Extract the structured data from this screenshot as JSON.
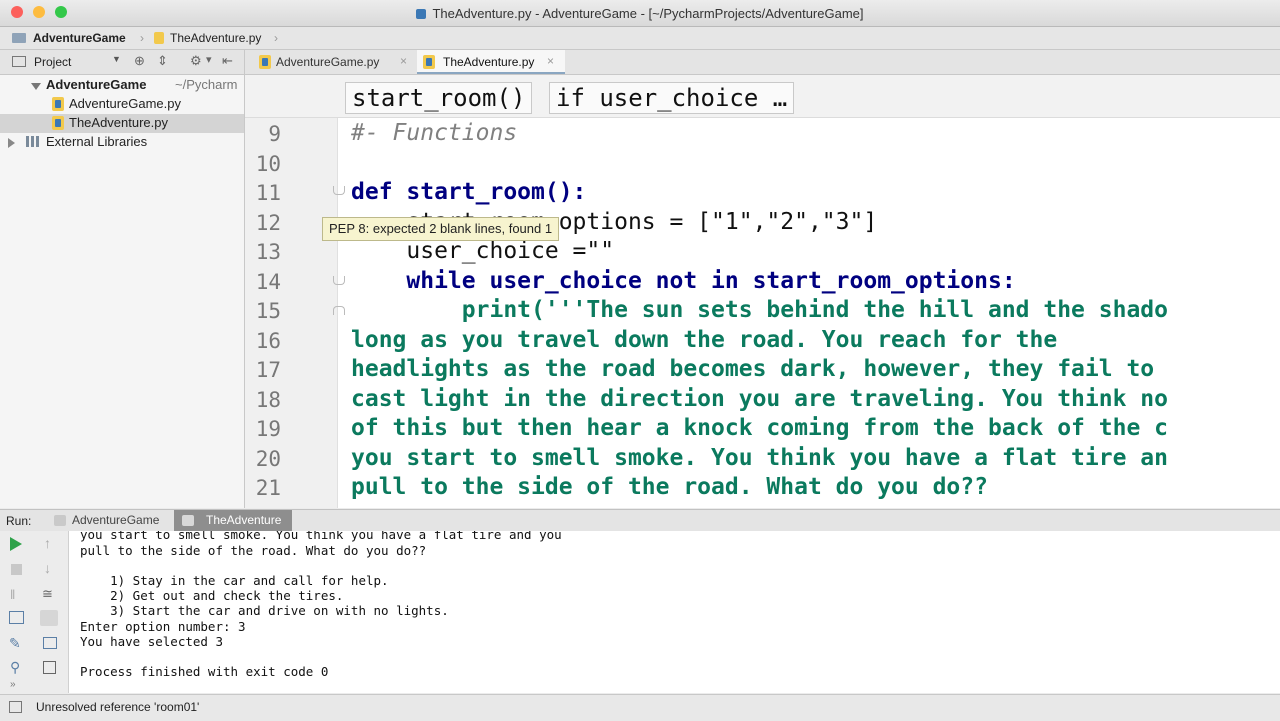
{
  "window": {
    "title": "TheAdventure.py - AdventureGame - [~/PycharmProjects/AdventureGame]",
    "colors": {
      "close": "#fc605c",
      "minimize": "#fdbc40",
      "zoom": "#34c84a"
    }
  },
  "navbar": {
    "crumbs": [
      "AdventureGame",
      "TheAdventure.py"
    ]
  },
  "project": {
    "header_label": "Project",
    "tree": [
      {
        "label": "AdventureGame",
        "suffix": "~/Pycharm",
        "type": "folder",
        "depth": 0,
        "expanded": true,
        "selected": false
      },
      {
        "label": "AdventureGame.py",
        "suffix": "",
        "type": "file",
        "depth": 1,
        "expanded": false,
        "selected": false
      },
      {
        "label": "TheAdventure.py",
        "suffix": "",
        "type": "file",
        "depth": 1,
        "expanded": false,
        "selected": true
      },
      {
        "label": "External Libraries",
        "suffix": "",
        "type": "library",
        "depth": 0,
        "expanded": false,
        "selected": false
      }
    ]
  },
  "editor_tabs": [
    {
      "label": "AdventureGame.py",
      "active": false
    },
    {
      "label": "TheAdventure.py",
      "active": true
    }
  ],
  "code_breadcrumb": [
    "start_room()",
    "if user_choice …"
  ],
  "editor": {
    "lines": [
      {
        "num": "9",
        "text": "#- Functions"
      },
      {
        "num": "10",
        "text": ""
      },
      {
        "num": "11",
        "text": "def start_room():"
      },
      {
        "num": "12",
        "text": "    start_room_options = [\"1\",\"2\",\"3\"]"
      },
      {
        "num": "13",
        "text": "    user_choice =\"\""
      },
      {
        "num": "14",
        "text": "    while user_choice not in start_room_options:"
      },
      {
        "num": "15",
        "text": "        print('''The sun sets behind the hill and the shado"
      },
      {
        "num": "16",
        "text": "long as you travel down the road. You reach for the"
      },
      {
        "num": "17",
        "text": "headlights as the road becomes dark, however, they fail to"
      },
      {
        "num": "18",
        "text": "cast light in the direction you are traveling. You think no"
      },
      {
        "num": "19",
        "text": "of this but then hear a knock coming from the back of the c"
      },
      {
        "num": "20",
        "text": "you start to smell smoke. You think you have a flat tire an"
      },
      {
        "num": "21",
        "text": "pull to the side of the road. What do you do??"
      }
    ],
    "tooltip": "PEP 8: expected 2 blank lines, found 1"
  },
  "run": {
    "label": "Run:",
    "tabs": [
      {
        "label": "AdventureGame",
        "active": false
      },
      {
        "label": "TheAdventure",
        "active": true
      }
    ],
    "console": [
      "you start to smell smoke. You think you have a flat tire and you",
      "pull to the side of the road. What do you do??",
      "",
      "    1) Stay in the car and call for help.",
      "    2) Get out and check the tires.",
      "    3) Start the car and drive on with no lights.",
      "Enter option number: 3",
      "You have selected 3",
      "",
      "Process finished with exit code 0"
    ]
  },
  "status": {
    "message": "Unresolved reference 'room01'"
  }
}
